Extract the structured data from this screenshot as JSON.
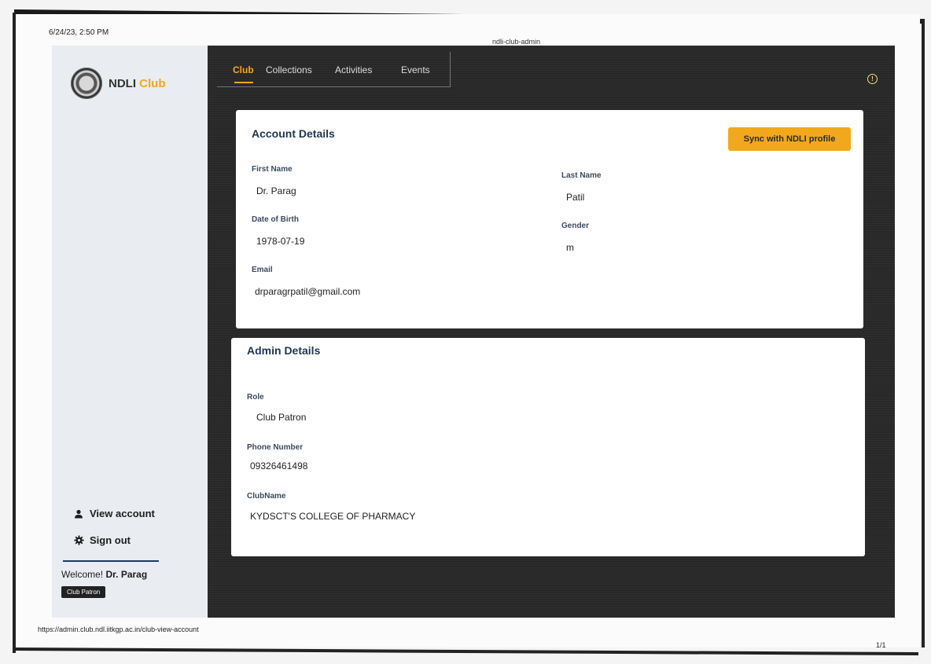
{
  "print_header": {
    "date": "6/24/23, 2:50 PM",
    "title": "ndli-club-admin"
  },
  "print_footer": {
    "url": "https://admin.club.ndl.iitkgp.ac.in/club-view-account",
    "page": "1/1"
  },
  "brand": {
    "name": "NDLI",
    "accent": "Club",
    "accent_color": "#f2a81c"
  },
  "tabs": [
    "Club",
    "Collections",
    "Activities",
    "Events"
  ],
  "sidebar": {
    "view_account": "View account",
    "sign_out": "Sign out",
    "welcome_prefix": "Welcome!",
    "welcome_name": "Dr. Parag",
    "role_badge": "Club Patron"
  },
  "account": {
    "title": "Account Details",
    "sync_button": "Sync with NDLI profile",
    "fields": {
      "first_name_label": "First Name",
      "first_name": "Dr. Parag",
      "last_name_label": "Last Name",
      "last_name": "Patil",
      "dob_label": "Date of Birth",
      "dob": "1978-07-19",
      "gender_label": "Gender",
      "gender": "m",
      "email_label": "Email",
      "email": "drparagrpatil@gmail.com"
    }
  },
  "admin": {
    "title": "Admin Details",
    "fields": {
      "role_label": "Role",
      "role": "Club Patron",
      "phone_label": "Phone Number",
      "phone": "09326461498",
      "club_label": "ClubName",
      "club": "KYDSCT'S COLLEGE OF PHARMACY"
    }
  },
  "icons": {
    "info": "info-icon",
    "user": "user-icon",
    "gear": "gear-icon"
  }
}
